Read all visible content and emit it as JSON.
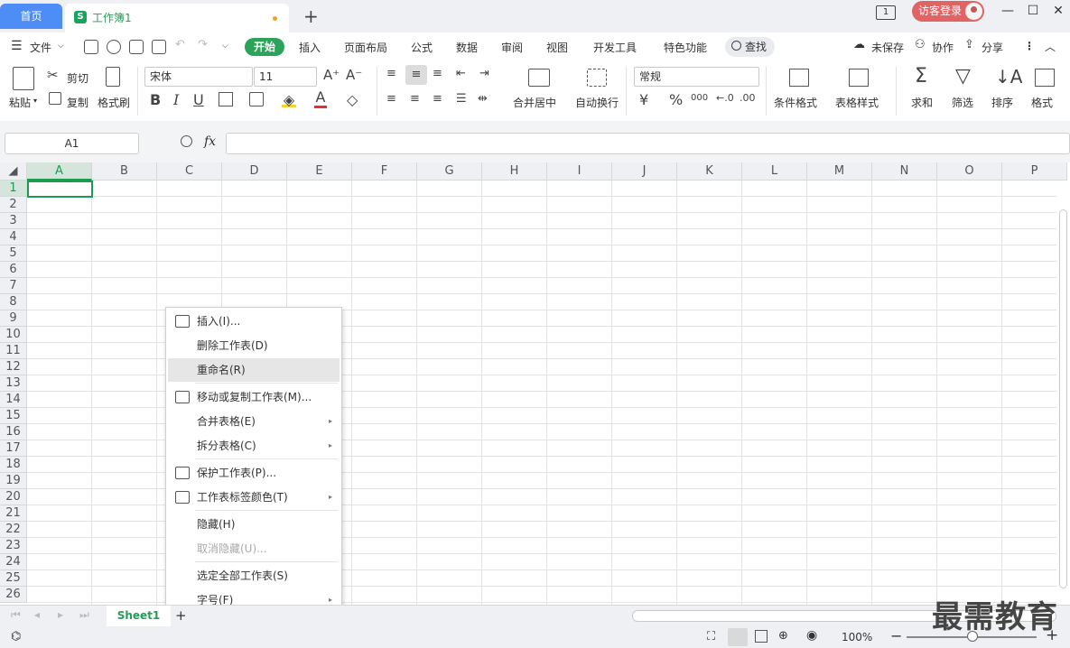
{
  "titlebar": {
    "home_tab": "首页",
    "doc_tab": "工作簿1",
    "doc_icon": "S",
    "new_tab": "+",
    "login": "访客登录",
    "page_indicator": "1"
  },
  "menubar": {
    "file": "文件",
    "tabs": [
      "开始",
      "插入",
      "页面布局",
      "公式",
      "数据",
      "审阅",
      "视图",
      "开发工具",
      "特色功能"
    ],
    "search": "查找",
    "unsaved": "未保存",
    "collab": "协作",
    "share": "分享"
  },
  "ribbon": {
    "paste": "粘贴",
    "cut": "剪切",
    "copy": "复制",
    "format_painter": "格式刷",
    "font_name": "宋体",
    "font_size": "11",
    "bold": "B",
    "italic": "I",
    "underline": "U",
    "merge_center": "合并居中",
    "wrap_text": "自动换行",
    "number_format": "常规",
    "currency": "¥",
    "percent": "%",
    "thousands": "000",
    "cond_format": "条件格式",
    "table_style": "表格样式",
    "sum": "求和",
    "filter": "筛选",
    "sort": "排序",
    "format": "格式"
  },
  "formula_bar": {
    "name_box": "A1",
    "fx": "fx",
    "value": ""
  },
  "grid": {
    "columns": [
      "A",
      "B",
      "C",
      "D",
      "E",
      "F",
      "G",
      "H",
      "I",
      "J",
      "K",
      "L",
      "M",
      "N",
      "O",
      "P"
    ],
    "rows": [
      "1",
      "2",
      "3",
      "4",
      "5",
      "6",
      "7",
      "8",
      "9",
      "10",
      "11",
      "12",
      "13",
      "14",
      "15",
      "16",
      "17",
      "18",
      "19",
      "20",
      "21",
      "22",
      "23",
      "24",
      "25",
      "26"
    ],
    "active_cell": "A1"
  },
  "context_menu": {
    "items": [
      {
        "label": "插入(I)...",
        "icon": "insert-sheet-icon"
      },
      {
        "label": "删除工作表(D)"
      },
      {
        "label": "重命名(R)",
        "highlighted": true
      },
      {
        "label": "移动或复制工作表(M)...",
        "icon": "move-copy-icon"
      },
      {
        "label": "合并表格(E)",
        "submenu": true
      },
      {
        "label": "拆分表格(C)",
        "submenu": true
      },
      {
        "label": "保护工作表(P)...",
        "icon": "protect-sheet-icon"
      },
      {
        "label": "工作表标签颜色(T)",
        "icon": "tab-color-icon",
        "submenu": true
      },
      {
        "label": "隐藏(H)"
      },
      {
        "label": "取消隐藏(U)...",
        "disabled": true
      },
      {
        "label": "选定全部工作表(S)"
      },
      {
        "label": "字号(F)",
        "submenu": true
      }
    ]
  },
  "sheetbar": {
    "sheet_name": "Sheet1",
    "add": "+"
  },
  "statusbar": {
    "zoom": "100%",
    "zoom_out": "−",
    "zoom_in": "+"
  },
  "watermark": "最需教育",
  "colors": {
    "accent_green": "#2ba35a",
    "home_tab_blue": "#4e8df5",
    "login_red": "#e06464"
  }
}
